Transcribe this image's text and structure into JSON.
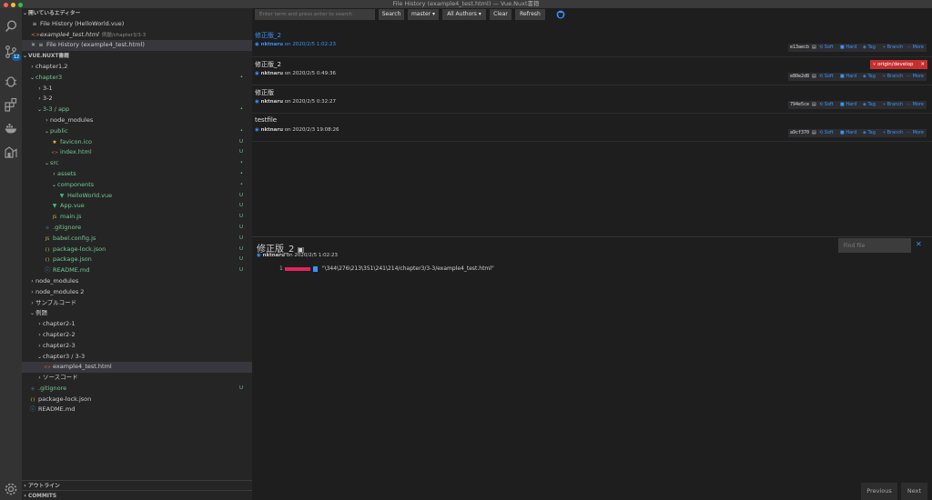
{
  "window": {
    "title": "File History (example4_test.html) — Vue.Nuxt書籍",
    "dot_colors": [
      "#ff5f57",
      "#febc2e",
      "#28c840"
    ]
  },
  "activity": {
    "scm_badge": "12"
  },
  "sidebar": {
    "open_editors_header": "開いているエディター",
    "open_editors": [
      {
        "label": "File History (HelloWorld.vue)",
        "desc": "",
        "icon": "history-icon",
        "selected": false
      },
      {
        "label": "example4_test.html",
        "desc": "例題/chapter3/3-3",
        "icon": "html-file-icon",
        "selected": false
      },
      {
        "label": "File History (example4_test.html)",
        "desc": "",
        "icon": "history-icon",
        "selected": true
      }
    ],
    "explorer_header": "VUE.NUXT書籍",
    "tree": [
      {
        "label": "chapter1,2",
        "depth": 1,
        "type": "folder",
        "open": false,
        "status": "",
        "color": "#cccccc"
      },
      {
        "label": "chapter3",
        "depth": 1,
        "type": "folder",
        "open": true,
        "status": "•",
        "color": "#73c991"
      },
      {
        "label": "3-1",
        "depth": 2,
        "type": "folder",
        "open": false,
        "status": "",
        "color": "#cccccc"
      },
      {
        "label": "3-2",
        "depth": 2,
        "type": "folder",
        "open": false,
        "status": "",
        "color": "#cccccc"
      },
      {
        "label": "3-3 / app",
        "depth": 2,
        "type": "folder",
        "open": true,
        "status": "•",
        "color": "#73c991"
      },
      {
        "label": "node_modules",
        "depth": 3,
        "type": "folder",
        "open": false,
        "status": "",
        "color": "#cccccc"
      },
      {
        "label": "public",
        "depth": 3,
        "type": "folder",
        "open": true,
        "status": "•",
        "color": "#73c991"
      },
      {
        "label": "favicon.ico",
        "depth": 4,
        "type": "ico",
        "open": false,
        "status": "U",
        "color": "#73c991"
      },
      {
        "label": "index.html",
        "depth": 4,
        "type": "html",
        "open": false,
        "status": "U",
        "color": "#73c991"
      },
      {
        "label": "src",
        "depth": 3,
        "type": "folder",
        "open": true,
        "status": "•",
        "color": "#73c991"
      },
      {
        "label": "assets",
        "depth": 4,
        "type": "folder",
        "open": false,
        "status": "•",
        "color": "#73c991"
      },
      {
        "label": "components",
        "depth": 4,
        "type": "folder",
        "open": true,
        "status": "•",
        "color": "#73c991"
      },
      {
        "label": "HelloWorld.vue",
        "depth": 5,
        "type": "vue",
        "open": false,
        "status": "U",
        "color": "#73c991"
      },
      {
        "label": "App.vue",
        "depth": 4,
        "type": "vue",
        "open": false,
        "status": "U",
        "color": "#73c991"
      },
      {
        "label": "main.js",
        "depth": 4,
        "type": "js",
        "open": false,
        "status": "U",
        "color": "#73c991"
      },
      {
        "label": ".gitignore",
        "depth": 3,
        "type": "git",
        "open": false,
        "status": "U",
        "color": "#73c991"
      },
      {
        "label": "babel.config.js",
        "depth": 3,
        "type": "js",
        "open": false,
        "status": "U",
        "color": "#73c991"
      },
      {
        "label": "package-lock.json",
        "depth": 3,
        "type": "json",
        "open": false,
        "status": "U",
        "color": "#73c991"
      },
      {
        "label": "package.json",
        "depth": 3,
        "type": "json",
        "open": false,
        "status": "U",
        "color": "#73c991"
      },
      {
        "label": "README.md",
        "depth": 3,
        "type": "md",
        "open": false,
        "status": "U",
        "color": "#73c991"
      },
      {
        "label": "node_modules",
        "depth": 1,
        "type": "folder",
        "open": false,
        "status": "",
        "color": "#cccccc"
      },
      {
        "label": "node_modules 2",
        "depth": 1,
        "type": "folder",
        "open": false,
        "status": "",
        "color": "#cccccc"
      },
      {
        "label": "サンプルコード",
        "depth": 1,
        "type": "folder",
        "open": false,
        "status": "",
        "color": "#cccccc"
      },
      {
        "label": "例題",
        "depth": 1,
        "type": "folder",
        "open": true,
        "status": "",
        "color": "#cccccc"
      },
      {
        "label": "chapter2-1",
        "depth": 2,
        "type": "folder",
        "open": false,
        "status": "",
        "color": "#cccccc"
      },
      {
        "label": "chapter2-2",
        "depth": 2,
        "type": "folder",
        "open": false,
        "status": "",
        "color": "#cccccc"
      },
      {
        "label": "chapter2-3",
        "depth": 2,
        "type": "folder",
        "open": false,
        "status": "",
        "color": "#cccccc"
      },
      {
        "label": "chapter3 / 3-3",
        "depth": 2,
        "type": "folder",
        "open": true,
        "status": "",
        "color": "#cccccc"
      },
      {
        "label": "example4_test.html",
        "depth": 3,
        "type": "html",
        "open": false,
        "status": "",
        "color": "#cccccc",
        "selected": true
      },
      {
        "label": "ソースコード",
        "depth": 2,
        "type": "folder",
        "open": false,
        "status": "",
        "color": "#cccccc"
      },
      {
        "label": ".gitignore",
        "depth": 1,
        "type": "git",
        "open": false,
        "status": "U",
        "color": "#73c991"
      },
      {
        "label": "package-lock.json",
        "depth": 1,
        "type": "json",
        "open": false,
        "status": "",
        "color": "#cccccc"
      },
      {
        "label": "README.md",
        "depth": 1,
        "type": "md",
        "open": false,
        "status": "",
        "color": "#cccccc"
      }
    ],
    "outline_header": "アウトライン",
    "commits_header": "COMMITS"
  },
  "toolbar": {
    "search_placeholder": "Enter term and press enter to search",
    "search_button": "Search",
    "branch_select": "master ▾",
    "authors_select": "All Authors ▾",
    "clear_button": "Clear",
    "refresh_button": "Refresh"
  },
  "commits": [
    {
      "message": "修正版_2",
      "author": "nktnaru",
      "date": "on 2020/2/5 1:02:23",
      "hash": "e13aecb",
      "highlighted": true,
      "branch": ""
    },
    {
      "message": "修正版_2",
      "author": "nktnaru",
      "date": "on 2020/2/5 0:49:36",
      "hash": "e80e2d8",
      "highlighted": false,
      "branch": "origin/develop"
    },
    {
      "message": "修正版",
      "author": "nktnaru",
      "date": "on 2020/2/5 0:32:27",
      "hash": "794e5ce",
      "highlighted": false,
      "branch": ""
    },
    {
      "message": "testfile",
      "author": "nktnaru",
      "date": "on 2020/2/3 19:08:26",
      "hash": "a9cf370",
      "highlighted": false,
      "branch": ""
    }
  ],
  "commit_actions": [
    "Soft",
    "Hard",
    "Tag",
    "Branch",
    "More"
  ],
  "details": {
    "message": "修正版_2",
    "author": "nktnaru",
    "date": "on 2020/2/5 1:02:23",
    "find_placeholder": "Find file",
    "file_index": "1",
    "file_path": "\"\\344\\276\\213\\351\\241\\214/chapter3/3-3/example4_test.html\""
  },
  "pager": {
    "previous": "Previous",
    "next": "Next"
  }
}
